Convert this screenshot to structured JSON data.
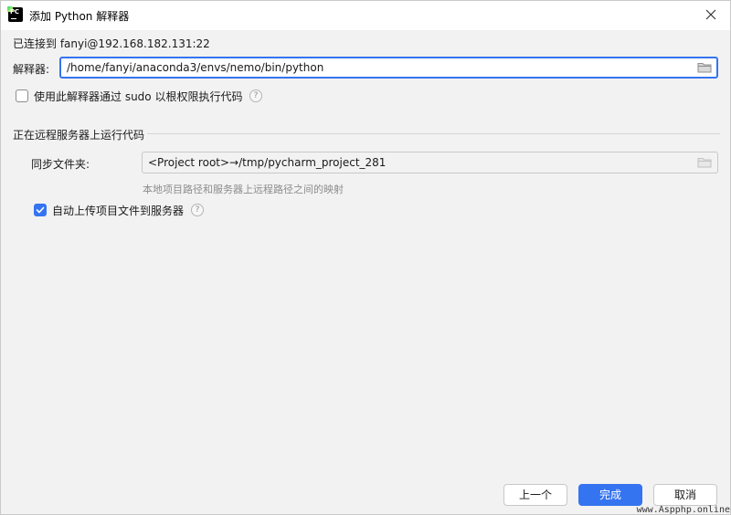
{
  "window": {
    "title": "添加 Python 解释器",
    "app_icon_text": "PC"
  },
  "connection": {
    "status_text": "已连接到 fanyi@192.168.182.131:22"
  },
  "interpreter": {
    "label": "解释器:",
    "value": "/home/fanyi/anaconda3/envs/nemo/bin/python"
  },
  "sudo": {
    "label": "使用此解释器通过 sudo 以根权限执行代码",
    "checked": false
  },
  "remote_section": {
    "title": "正在远程服务器上运行代码",
    "sync_label": "同步文件夹:",
    "sync_value": "<Project root>→/tmp/pycharm_project_281",
    "sync_hint": "本地项目路径和服务器上远程路径之间的映射",
    "auto_upload_label": "自动上传项目文件到服务器",
    "auto_upload_checked": true
  },
  "buttons": {
    "prev": "上一个",
    "finish": "完成",
    "cancel": "取消"
  },
  "watermark": "www.Aspphp.online",
  "colors": {
    "accent": "#3574f0",
    "background": "#f2f2f2",
    "hint_text": "#8c8c8c"
  },
  "icons": {
    "close": "close-icon",
    "folder": "folder-icon",
    "help": "help-icon",
    "check": "checkmark-icon"
  }
}
